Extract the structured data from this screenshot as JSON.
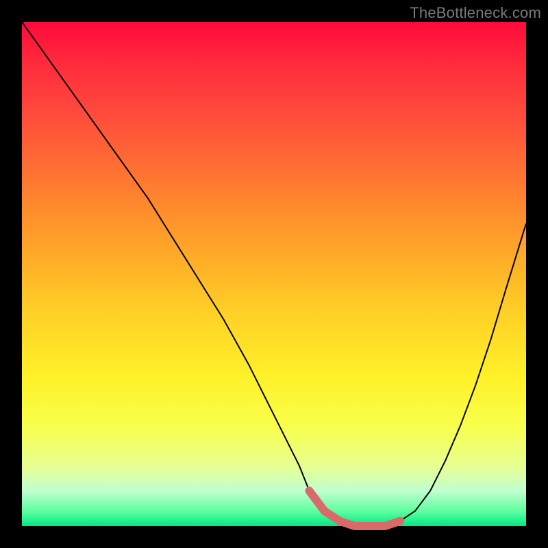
{
  "watermark": "TheBottleneck.com",
  "colors": {
    "frame": "#000000",
    "curve_thin": "#000000",
    "curve_thick": "#d86a6a"
  },
  "chart_data": {
    "type": "line",
    "title": "",
    "xlabel": "",
    "ylabel": "",
    "xlim": [
      0,
      100
    ],
    "ylim": [
      0,
      100
    ],
    "series": [
      {
        "name": "bottleneck-curve",
        "x": [
          0,
          5,
          10,
          15,
          20,
          25,
          30,
          35,
          40,
          45,
          50,
          55,
          57,
          60,
          63,
          66,
          69,
          72,
          75,
          78,
          81,
          84,
          87,
          90,
          93,
          96,
          100
        ],
        "values": [
          100,
          93,
          86,
          79,
          72,
          65,
          57,
          49,
          41,
          32,
          22,
          12,
          7,
          3,
          1,
          0,
          0,
          0,
          1,
          3,
          7,
          13,
          20,
          28,
          37,
          47,
          60
        ]
      }
    ],
    "highlight_range_x": [
      56,
      76
    ],
    "annotations": []
  }
}
